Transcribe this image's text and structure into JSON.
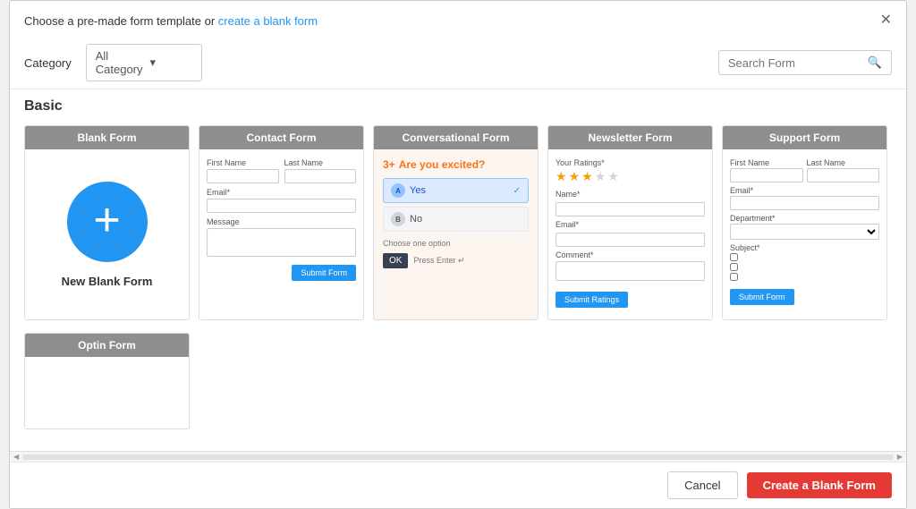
{
  "modal": {
    "header_text": "Choose a pre-made form template or ",
    "link_text": "create a blank form",
    "close_icon": "✕"
  },
  "toolbar": {
    "category_label": "Category",
    "category_value": "All Category",
    "search_placeholder": "Search Form"
  },
  "sections": [
    {
      "title": "Basic",
      "cards": [
        {
          "id": "blank",
          "header": "Blank Form",
          "body_type": "blank",
          "label": "New Blank Form"
        },
        {
          "id": "contact",
          "header": "Contact Form",
          "body_type": "contact"
        },
        {
          "id": "conversational",
          "header": "Conversational Form",
          "body_type": "conversational"
        },
        {
          "id": "newsletter",
          "header": "Newsletter Form",
          "body_type": "newsletter"
        },
        {
          "id": "support",
          "header": "Support Form",
          "body_type": "support"
        }
      ]
    },
    {
      "title": "",
      "cards": [
        {
          "id": "optin",
          "header": "Optin Form",
          "body_type": "optin"
        }
      ]
    }
  ],
  "contact_form": {
    "first_name_label": "First Name",
    "last_name_label": "Last Name",
    "email_label": "Email*",
    "message_label": "Message",
    "submit_label": "Submit Form"
  },
  "conv_form": {
    "step": "3+",
    "question": "Are you excited?",
    "option_a_letter": "A",
    "option_a_text": "Yes",
    "option_b_letter": "B",
    "option_b_text": "No",
    "hint": "Choose one option",
    "ok_label": "OK",
    "ok_hint": "Press Enter ↵"
  },
  "newsletter_form": {
    "ratings_label": "Your Ratings*",
    "name_label": "Name*",
    "email_label": "Email*",
    "comment_label": "Comment*",
    "submit_label": "Submit Ratings",
    "stars": [
      true,
      true,
      true,
      false,
      false
    ]
  },
  "support_form": {
    "first_name_label": "First Name",
    "last_name_label": "Last Name",
    "email_label": "Email*",
    "department_label": "Department*",
    "subject_label": "Subject*",
    "submit_label": "Submit Form"
  },
  "footer": {
    "cancel_label": "Cancel",
    "create_label": "Create a Blank Form"
  }
}
